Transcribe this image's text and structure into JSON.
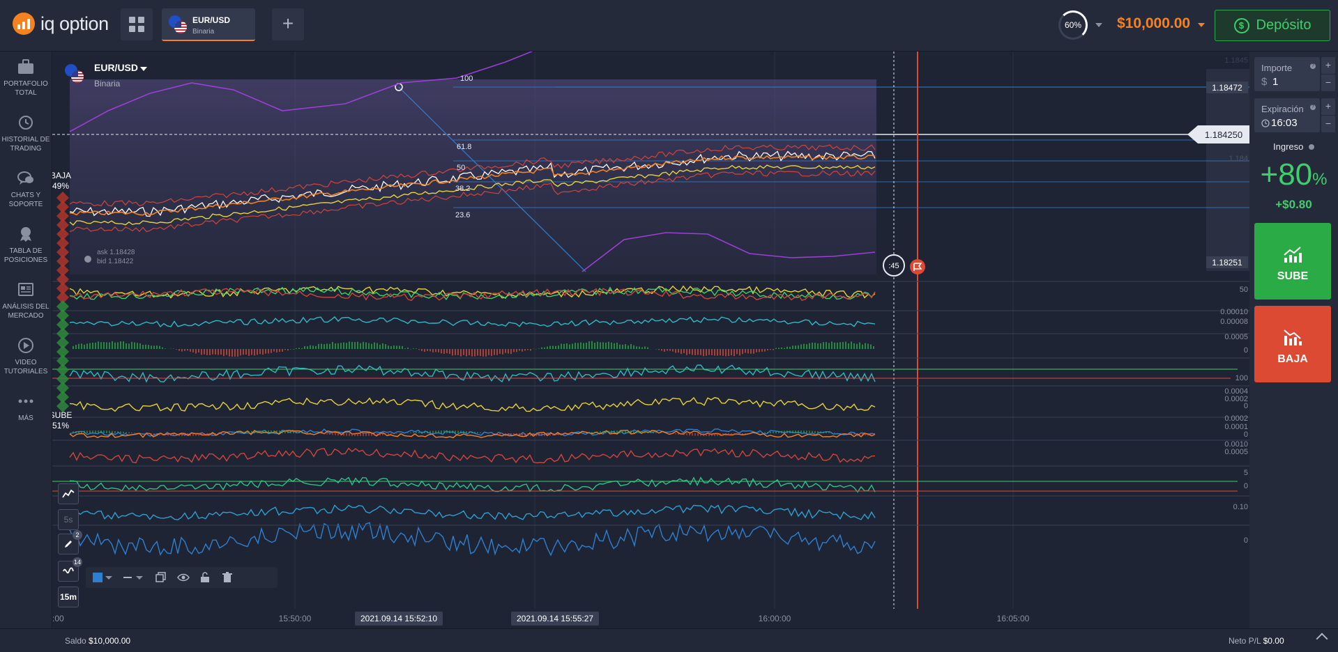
{
  "brand": {
    "name": "iq option",
    "accent": "#f58220"
  },
  "header": {
    "asset_tab": {
      "name": "EUR/USD",
      "type": "Binaria"
    },
    "add_icon": "+",
    "timer_percent": "60%",
    "balance": "$10,000.00",
    "deposit_label": "Depósito"
  },
  "sidebar": {
    "items": [
      {
        "label": "PORTAFOLIO TOTAL",
        "icon": "briefcase-icon"
      },
      {
        "label": "HISTORIAL DE TRADING",
        "icon": "history-icon"
      },
      {
        "label": "CHATS Y SOPORTE",
        "icon": "chat-icon"
      },
      {
        "label": "TABLA DE POSICIONES",
        "icon": "trophy-icon"
      },
      {
        "label": "ANÁLISIS DEL MERCADO",
        "icon": "newspaper-icon"
      },
      {
        "label": "VIDEO TUTORIALES",
        "icon": "play-icon"
      },
      {
        "label": "MÁS",
        "icon": "more-icon"
      }
    ]
  },
  "chart": {
    "asset": "EUR/USD",
    "asset_type": "Binaria",
    "sentiment": {
      "down_label": "BAJA",
      "down_pct": "49%",
      "up_label": "SUBE",
      "up_pct": "51%"
    },
    "ask": "ask 1.18428",
    "bid": "bid 1.18422",
    "current_price": "1.184250",
    "price_high": "1.18472",
    "price_low": "1.18251",
    "axis_faint_top": "1.1845",
    "axis_mid": "1.184",
    "fib_levels": [
      "100",
      "61.8",
      "50",
      "38.2",
      "23.6"
    ],
    "countdown": ":45",
    "indicator_axis": [
      "50",
      "0.00010",
      "0.00008",
      "0.0005",
      "0",
      "100",
      "0.0004",
      "0.0002",
      "0",
      "0.0002",
      "0.0001",
      "0",
      "0.0010",
      "0.0005",
      "5",
      "0",
      "0.10",
      "0"
    ],
    "x_ticks": [
      ":00",
      "15:50:00",
      "16:00:00",
      "16:05:00"
    ],
    "time_pills": [
      "2021.09.14 15:52:10",
      "2021.09.14 15:55:27"
    ],
    "tools": {
      "timeframe_small": "5s",
      "timeframe": "15m",
      "drawing_badge": "2",
      "indicator_badge": "14"
    }
  },
  "trade_panel": {
    "amount_label": "Importe",
    "amount_currency": "$",
    "amount_value": "1",
    "expiry_label": "Expiración",
    "expiry_value": "16:03",
    "payout_label": "Ingreso",
    "payout_value": "+80",
    "payout_unit": "%",
    "profit": "+$0.80",
    "buy_label": "SUBE",
    "sell_label": "BAJA",
    "colors": {
      "buy": "#2bab45",
      "sell": "#dc4a34"
    }
  },
  "footer": {
    "balance_label": "Saldo",
    "balance_value": "$10,000.00",
    "pnl_label": "Neto P/L",
    "pnl_value": "$0.00"
  }
}
